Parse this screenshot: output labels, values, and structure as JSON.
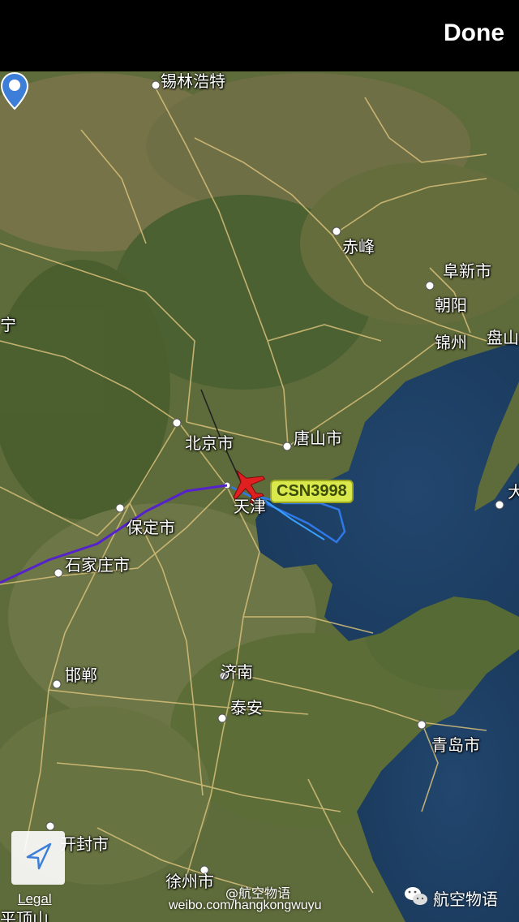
{
  "header": {
    "done_label": "Done"
  },
  "map": {
    "type": "satellite",
    "flight": {
      "callsign": "CSN3998",
      "color": "#e02020"
    },
    "route_colors": {
      "flown": "#5522cc",
      "recent": "#3aa0ff",
      "projected": "#222222"
    },
    "cities": {
      "xilinhot": "锡林浩特",
      "chifeng": "赤峰",
      "fuxin": "阜新市",
      "chaoyang": "朝阳",
      "jinzhou": "锦州",
      "panshan": "盘山",
      "ning": "宁",
      "beijing": "北京市",
      "tangshan": "唐山市",
      "tianjin": "天津",
      "baoding": "保定市",
      "shijiazhuang": "石家庄市",
      "dalian": "大",
      "handan": "邯郸",
      "jinan": "济南",
      "taian": "泰安",
      "qingdao": "青岛市",
      "kaifeng": "开封市",
      "xuzhou": "徐州市",
      "pingdingshan": "平顶山"
    }
  },
  "controls": {
    "legal_label": "Legal",
    "compass_icon": "location-arrow-icon"
  },
  "watermark": {
    "weibo_name": "@航空物语",
    "weibo_url": "weibo.com/hangkongwuyu",
    "wechat_name": "航空物语"
  }
}
